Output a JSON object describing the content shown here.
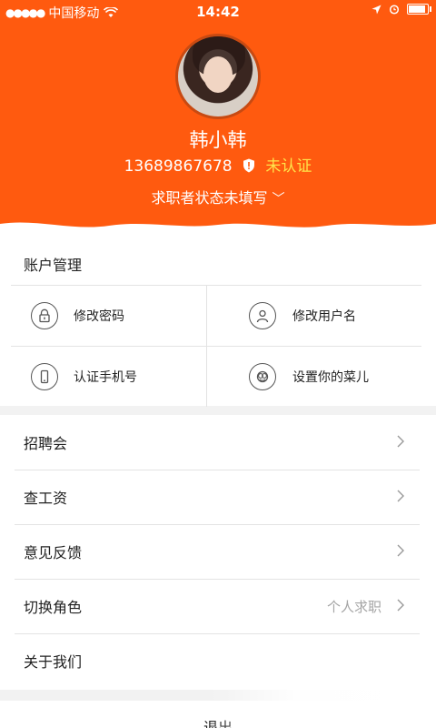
{
  "status_bar": {
    "signal": "●●●●●",
    "carrier": "中国移动",
    "time": "14:42"
  },
  "profile": {
    "name": "韩小韩",
    "phone": "13689867678",
    "verify_status": "未认证",
    "job_status": "求职者状态未填写",
    "job_status_chevron": "﹀"
  },
  "account_section": {
    "title": "账户管理",
    "items": [
      {
        "label": "修改密码",
        "icon": "lock-icon"
      },
      {
        "label": "修改用户名",
        "icon": "user-icon"
      },
      {
        "label": "认证手机号",
        "icon": "phone-icon"
      },
      {
        "label": "设置你的菜儿",
        "icon": "flower-icon"
      }
    ]
  },
  "menu": [
    {
      "label": "招聘会",
      "value": ""
    },
    {
      "label": "查工资",
      "value": ""
    },
    {
      "label": "意见反馈",
      "value": ""
    },
    {
      "label": "切换角色",
      "value": "个人求职"
    },
    {
      "label": "关于我们",
      "value": ""
    }
  ],
  "logout_label": "退出",
  "colors": {
    "header": "#ff5a0f",
    "unverified": "#ffe34a",
    "background": "#f2f2f2"
  }
}
